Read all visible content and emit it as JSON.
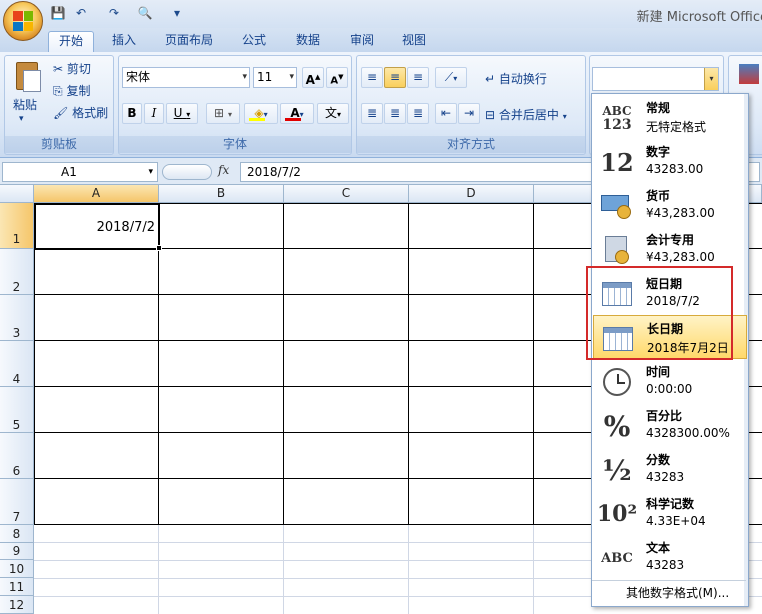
{
  "app": {
    "title": "新建 Microsoft Office"
  },
  "qat": {
    "save": "💾",
    "undo": "↶",
    "redo": "↷",
    "print_preview": "🔍",
    "more": "▾"
  },
  "tabs": [
    "开始",
    "插入",
    "页面布局",
    "公式",
    "数据",
    "审阅",
    "视图"
  ],
  "clipboard": {
    "paste": "粘贴",
    "cut": "剪切",
    "copy": "复制",
    "format_painter": "格式刷",
    "title": "剪贴板"
  },
  "font": {
    "name": "宋体",
    "size": "11",
    "grow": "A",
    "shrink": "A",
    "bold": "B",
    "italic": "I",
    "underline": "U",
    "title": "字体",
    "phonetic": "文"
  },
  "alignment": {
    "wrap": "自动换行",
    "merge": "合并后居中",
    "title": "对齐方式"
  },
  "number": {
    "format_value": ""
  },
  "formula": {
    "name_box": "A1",
    "fx": "fx",
    "content": "2018/7/2"
  },
  "columns": [
    "A",
    "B",
    "C",
    "D"
  ],
  "rows": [
    "1",
    "2",
    "3",
    "4",
    "5",
    "6",
    "7",
    "8",
    "9",
    "10",
    "11",
    "12"
  ],
  "cells": {
    "A1": "2018/7/2"
  },
  "formats": [
    {
      "name": "常规",
      "sample": "无特定格式",
      "icon": "ABC 123"
    },
    {
      "name": "数字",
      "sample": "43283.00",
      "icon": "12"
    },
    {
      "name": "货币",
      "sample": "¥43,283.00",
      "icon": "currency-icon"
    },
    {
      "name": "会计专用",
      "sample": " ¥43,283.00",
      "icon": "accounting-icon"
    },
    {
      "name": "短日期",
      "sample": "2018/7/2",
      "icon": "calendar-icon"
    },
    {
      "name": "长日期",
      "sample": "2018年7月2日",
      "icon": "calendar-icon"
    },
    {
      "name": "时间",
      "sample": "0:00:00",
      "icon": "clock-icon"
    },
    {
      "name": "百分比",
      "sample": "4328300.00%",
      "icon": "%"
    },
    {
      "name": "分数",
      "sample": "43283",
      "icon": "½"
    },
    {
      "name": "科学记数",
      "sample": "4.33E+04",
      "icon": "10²"
    },
    {
      "name": "文本",
      "sample": "43283",
      "icon": "ABC"
    }
  ],
  "more_formats": "其他数字格式(M)...",
  "highlight_color": "#d42a2a"
}
